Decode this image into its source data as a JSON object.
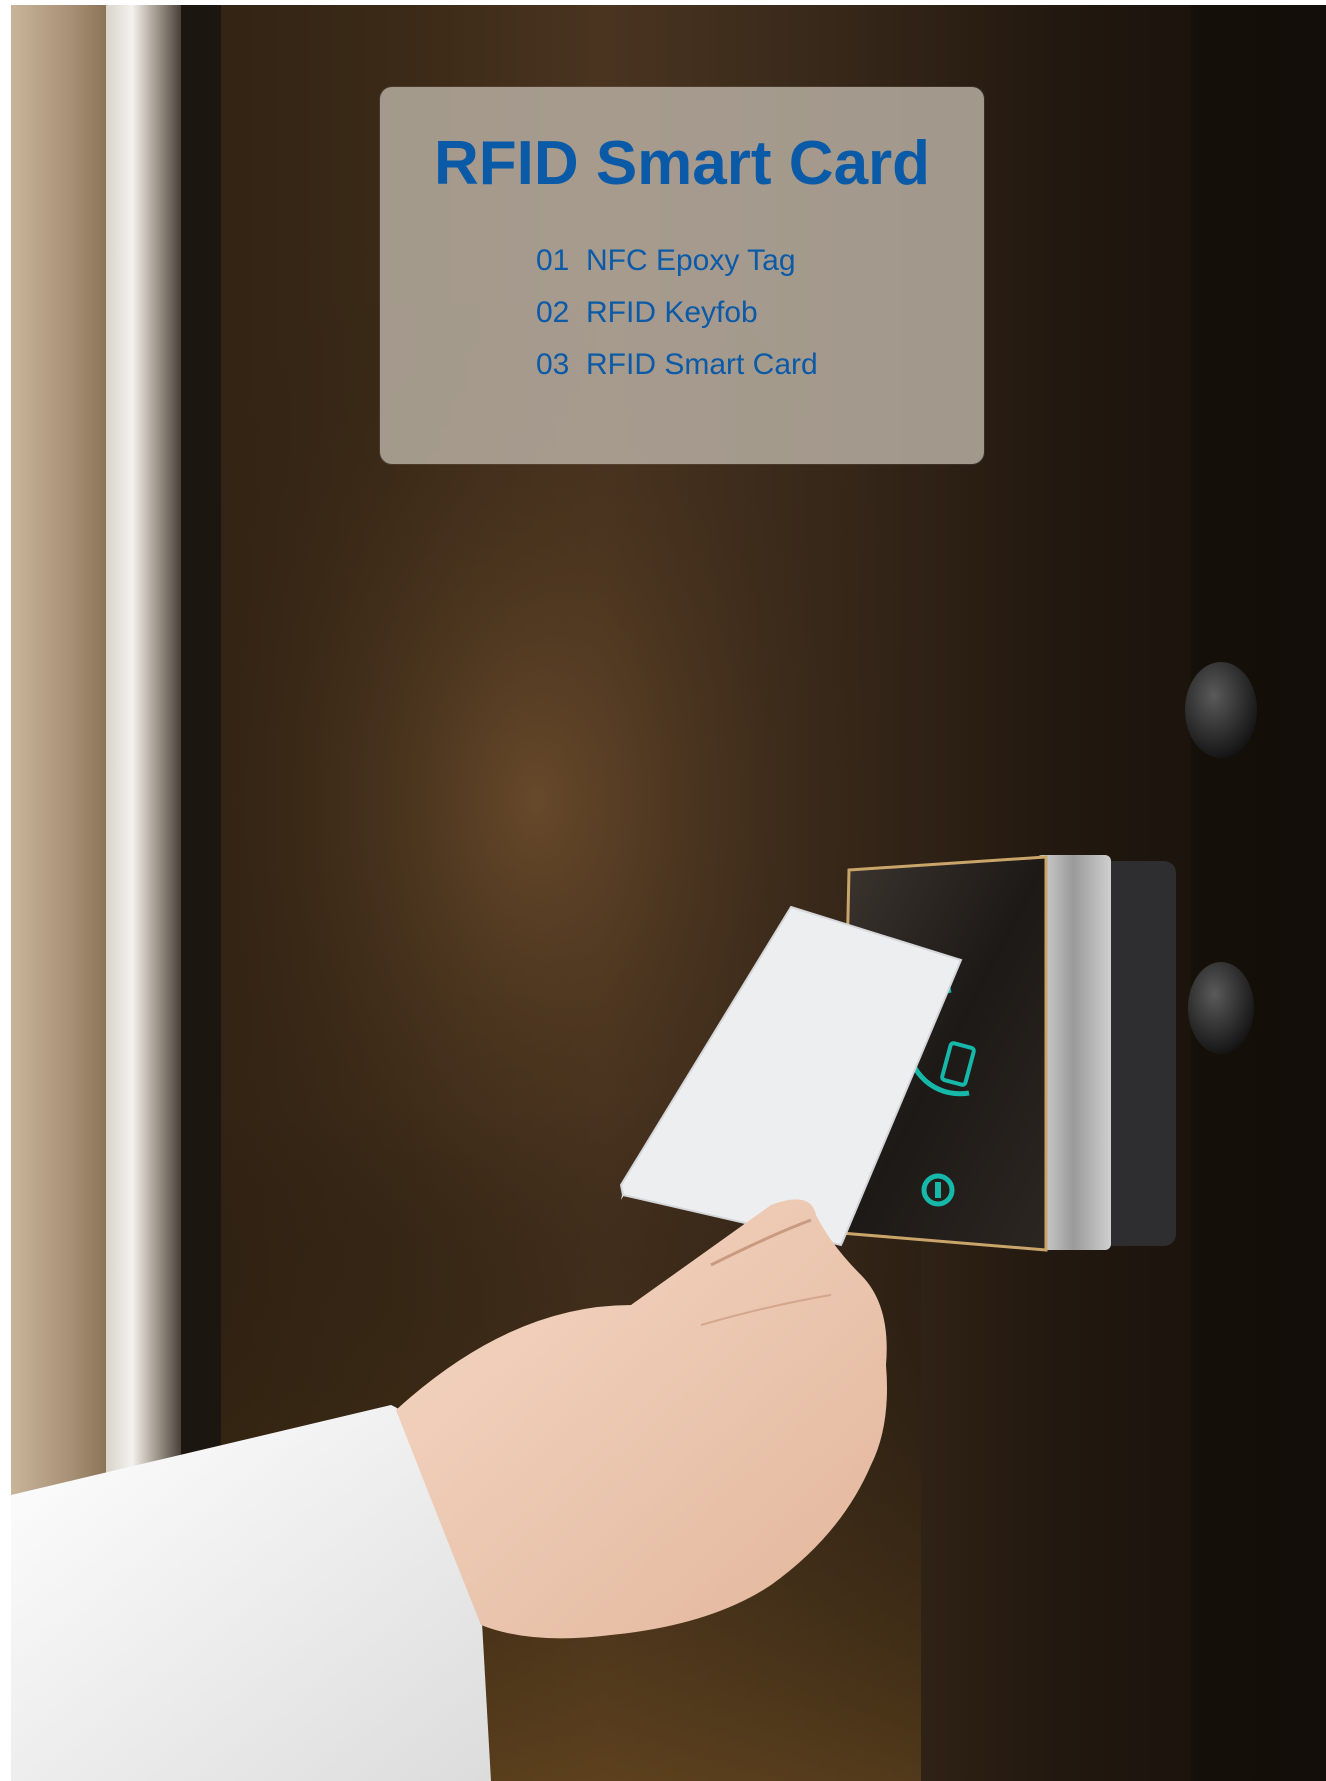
{
  "panel": {
    "title": "RFID Smart Card",
    "items": [
      {
        "number": "01",
        "label": "NFC Epoxy Tag"
      },
      {
        "number": "02",
        "label": "RFID Keyfob"
      },
      {
        "number": "03",
        "label": "RFID Smart Card"
      }
    ]
  },
  "photo": {
    "subject": [
      "hand-holding-card",
      "rfid-card-reader",
      "door-frame",
      "door-bumper-knob"
    ],
    "colors": {
      "title_text": "#0b5aa8",
      "reader_indicator": "#16b8a9",
      "card": "#e9eaec"
    }
  }
}
